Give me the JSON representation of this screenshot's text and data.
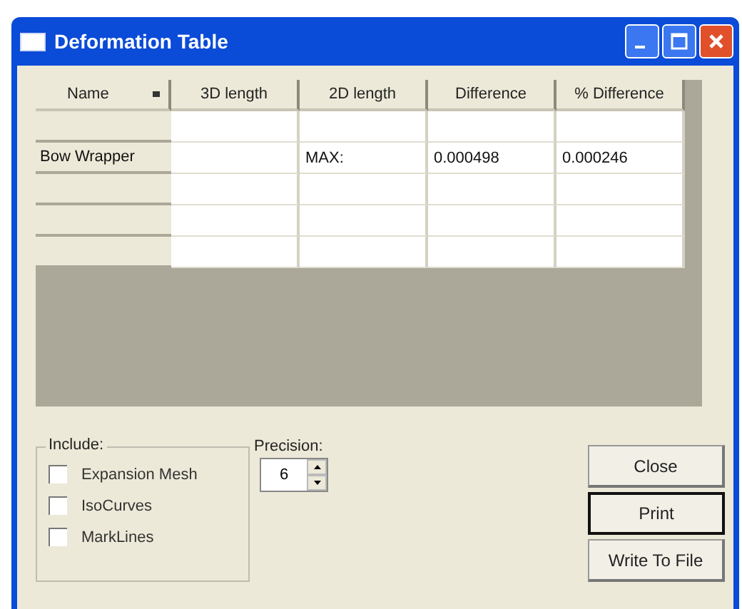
{
  "window": {
    "title": "Deformation Table"
  },
  "table": {
    "columns": [
      "Name",
      "3D length",
      "2D length",
      "Difference",
      "% Difference"
    ],
    "rows": [
      {
        "cells": [
          "",
          "",
          "",
          "",
          ""
        ]
      },
      {
        "cells": [
          "Bow Wrapper",
          "",
          "MAX:",
          "0.000498",
          "0.000246"
        ]
      },
      {
        "cells": [
          "",
          "",
          "",
          "",
          ""
        ]
      },
      {
        "cells": [
          "",
          "",
          "",
          "",
          ""
        ]
      },
      {
        "cells": [
          "",
          "",
          "",
          "",
          ""
        ]
      }
    ]
  },
  "include": {
    "label": "Include:",
    "options": [
      {
        "label": "Expansion Mesh",
        "checked": false
      },
      {
        "label": "IsoCurves",
        "checked": false
      },
      {
        "label": "MarkLines",
        "checked": false
      }
    ]
  },
  "precision": {
    "label": "Precision:",
    "value": "6"
  },
  "buttons": [
    {
      "label": "Close",
      "default": false
    },
    {
      "label": "Print",
      "default": true
    },
    {
      "label": "Write To File",
      "default": false
    }
  ]
}
